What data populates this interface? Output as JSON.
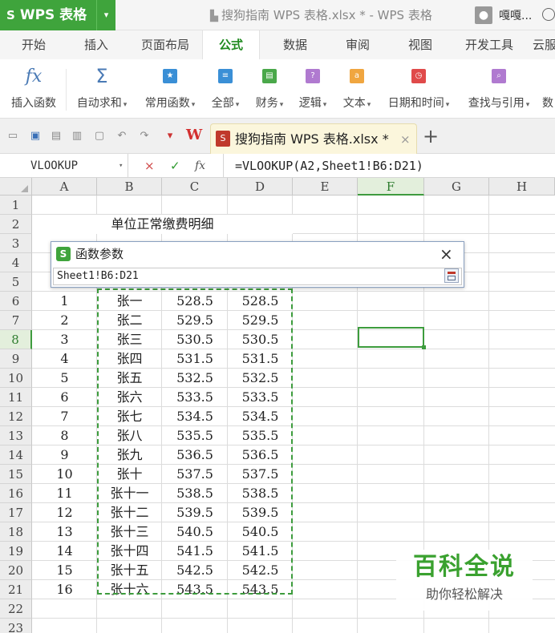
{
  "titlebar": {
    "app_name": "WPS 表格",
    "app_logo": "S",
    "title": "搜狗指南  WPS  表格.xlsx * - WPS 表格",
    "user_name": "嘎嘎..."
  },
  "menu": {
    "tabs": [
      "开始",
      "插入",
      "页面布局",
      "公式",
      "数据",
      "审阅",
      "视图",
      "开发工具",
      "云服"
    ],
    "active": "公式"
  },
  "ribbon": {
    "buttons": [
      {
        "label": "插入函数",
        "icon": "fx-icon",
        "dropdown": false
      },
      {
        "label": "自动求和",
        "icon": "sigma-icon",
        "dropdown": true
      },
      {
        "label": "常用函数",
        "icon": "star-icon",
        "dropdown": true,
        "color": "#3a8fd6",
        "glyph": "★"
      },
      {
        "label": "全部",
        "icon": "list-icon",
        "dropdown": true,
        "color": "#3a8fd6",
        "glyph": "≡"
      },
      {
        "label": "财务",
        "icon": "finance-icon",
        "dropdown": true,
        "color": "#4aa84a",
        "glyph": "▤"
      },
      {
        "label": "逻辑",
        "icon": "logic-icon",
        "dropdown": true,
        "color": "#b07ad0",
        "glyph": "?"
      },
      {
        "label": "文本",
        "icon": "text-icon",
        "dropdown": true,
        "color": "#f0a640",
        "glyph": "a"
      },
      {
        "label": "日期和时间",
        "icon": "clock-icon",
        "dropdown": true,
        "color": "#e04a4a",
        "glyph": "◷"
      },
      {
        "label": "查找与引用",
        "icon": "lookup-icon",
        "dropdown": true,
        "color": "#b07ad0",
        "glyph": "⌕"
      },
      {
        "label": "数",
        "icon": "math-icon",
        "dropdown": false
      }
    ]
  },
  "doc_tab": {
    "name": "搜狗指南  WPS  表格.xlsx *",
    "close": "×",
    "new_tab": "+"
  },
  "formula_bar": {
    "name_box": "VLOOKUP",
    "cancel": "×",
    "confirm": "✓",
    "fx": "fx",
    "formula": "=VLOOKUP(A2,Sheet1!B6:D21)"
  },
  "sheet": {
    "columns": [
      "A",
      "B",
      "C",
      "D",
      "E",
      "F",
      "G",
      "H"
    ],
    "selected_column": "F",
    "row_numbers": [
      "1",
      "2",
      "3",
      "4",
      "5",
      "6",
      "7",
      "8",
      "9",
      "10",
      "11",
      "12",
      "13",
      "14",
      "15",
      "16",
      "17",
      "18",
      "19",
      "20",
      "21",
      "22",
      "23"
    ],
    "selected_row": "8",
    "title": "单位正常缴费明细",
    "rows": [
      {
        "no": "1",
        "name": "张一",
        "c": "528.5",
        "d": "528.5"
      },
      {
        "no": "2",
        "name": "张二",
        "c": "529.5",
        "d": "529.5"
      },
      {
        "no": "3",
        "name": "张三",
        "c": "530.5",
        "d": "530.5"
      },
      {
        "no": "4",
        "name": "张四",
        "c": "531.5",
        "d": "531.5"
      },
      {
        "no": "5",
        "name": "张五",
        "c": "532.5",
        "d": "532.5"
      },
      {
        "no": "6",
        "name": "张六",
        "c": "533.5",
        "d": "533.5"
      },
      {
        "no": "7",
        "name": "张七",
        "c": "534.5",
        "d": "534.5"
      },
      {
        "no": "8",
        "name": "张八",
        "c": "535.5",
        "d": "535.5"
      },
      {
        "no": "9",
        "name": "张九",
        "c": "536.5",
        "d": "536.5"
      },
      {
        "no": "10",
        "name": "张十",
        "c": "537.5",
        "d": "537.5"
      },
      {
        "no": "11",
        "name": "张十一",
        "c": "538.5",
        "d": "538.5"
      },
      {
        "no": "12",
        "name": "张十二",
        "c": "539.5",
        "d": "539.5"
      },
      {
        "no": "13",
        "name": "张十三",
        "c": "540.5",
        "d": "540.5"
      },
      {
        "no": "14",
        "name": "张十四",
        "c": "541.5",
        "d": "541.5"
      },
      {
        "no": "15",
        "name": "张十五",
        "c": "542.5",
        "d": "542.5"
      },
      {
        "no": "16",
        "name": "张十六",
        "c": "543.5",
        "d": "543.5"
      }
    ]
  },
  "dialog": {
    "title": "函数参数",
    "close": "×",
    "input_value": "Sheet1!B6:D21"
  },
  "watermark": {
    "title": "百科全说",
    "subtitle": "助你轻松解决"
  },
  "colors": {
    "brand_green": "#3fa43c",
    "selection_green": "#3d9c3d"
  }
}
